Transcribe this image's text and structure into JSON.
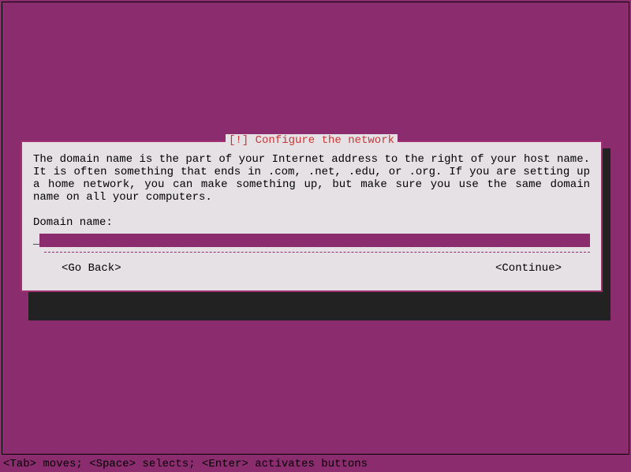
{
  "dialog": {
    "title": "[!] Configure the network",
    "description": "The domain name is the part of your Internet address to the right of your host name.  It is often something that ends in .com, .net, .edu, or .org.  If you are setting up a home network, you can make something up, but make sure you use the same domain name on all your computers.",
    "field_label": "Domain name:",
    "input_value": "",
    "go_back_label": "<Go Back>",
    "continue_label": "<Continue>"
  },
  "footer": {
    "help_text": "<Tab> moves; <Space> selects; <Enter> activates buttons"
  },
  "colors": {
    "background": "#8a2c6e",
    "panel": "#e6e1e5",
    "title": "#c83737"
  }
}
